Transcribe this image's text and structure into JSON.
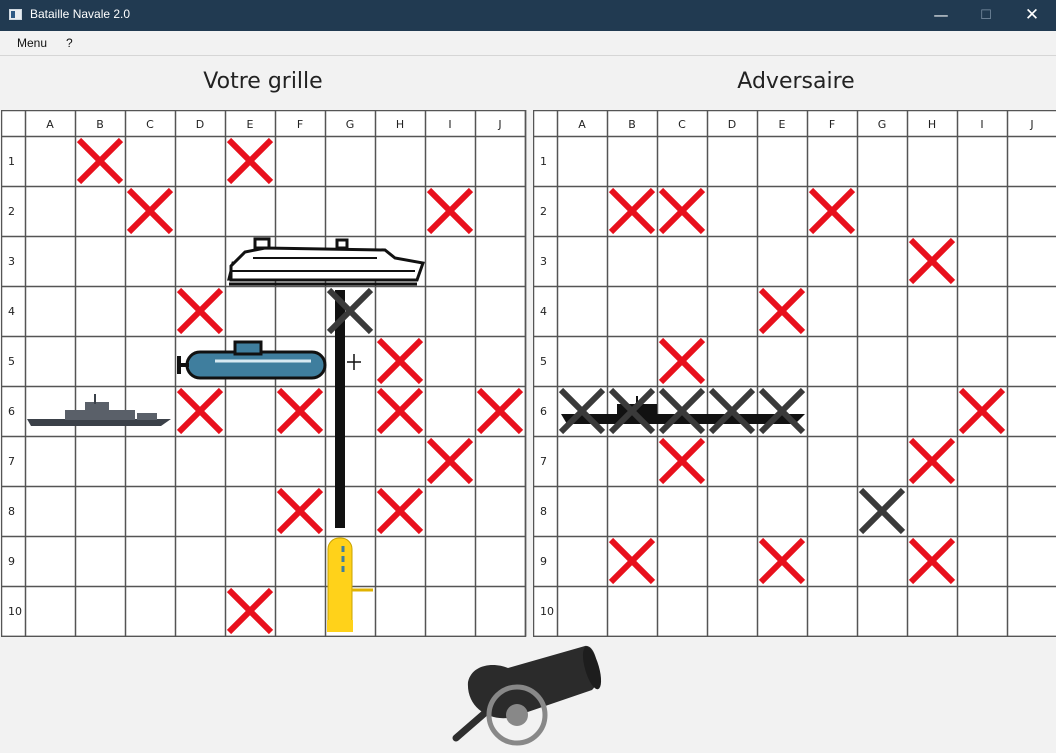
{
  "window": {
    "title": "Bataille Navale 2.0",
    "minimize": "—",
    "maximize": "☐",
    "close": "✕"
  },
  "menubar": {
    "items": [
      "Menu",
      "?"
    ]
  },
  "player_board": {
    "heading": "Votre grille",
    "columns": [
      "A",
      "B",
      "C",
      "D",
      "E",
      "F",
      "G",
      "H",
      "I",
      "J"
    ],
    "rows": [
      "1",
      "2",
      "3",
      "4",
      "5",
      "6",
      "7",
      "8",
      "9",
      "10"
    ],
    "misses": [
      "B1",
      "E1",
      "C2",
      "I2",
      "D4",
      "H5",
      "D6",
      "F6",
      "H6",
      "J6",
      "I7",
      "F8",
      "H8",
      "E10"
    ],
    "hits": [
      "G4"
    ],
    "ships": [
      {
        "name": "cruise-ship",
        "cells": [
          "E3",
          "F3",
          "G3",
          "H3"
        ],
        "orientation": "horizontal",
        "icon": "cruise-ship-icon"
      },
      {
        "name": "submarine",
        "cells": [
          "D5",
          "E5",
          "F5"
        ],
        "orientation": "horizontal",
        "icon": "submarine-icon"
      },
      {
        "name": "frigate",
        "cells": [
          "A6",
          "B6",
          "C6"
        ],
        "orientation": "horizontal",
        "icon": "frigate-icon"
      },
      {
        "name": "battleship",
        "cells": [
          "G4",
          "G5",
          "G6",
          "G7",
          "G8"
        ],
        "orientation": "vertical",
        "icon": "battleship-icon"
      },
      {
        "name": "yellow-submarine",
        "cells": [
          "G9",
          "G10"
        ],
        "orientation": "vertical",
        "icon": "yellow-submarine-icon"
      }
    ]
  },
  "opponent_board": {
    "heading": "Adversaire",
    "columns": [
      "A",
      "B",
      "C",
      "D",
      "E",
      "F",
      "G",
      "H",
      "I",
      "J"
    ],
    "rows": [
      "1",
      "2",
      "3",
      "4",
      "5",
      "6",
      "7",
      "8",
      "9",
      "10"
    ],
    "misses": [
      "B2",
      "C2",
      "F2",
      "H3",
      "E4",
      "C5",
      "I6",
      "C7",
      "H7",
      "B9",
      "E9",
      "H9"
    ],
    "hits": [
      "A6",
      "B6",
      "C6",
      "D6",
      "E6",
      "G8"
    ],
    "sunk_ships": [
      {
        "name": "sunk-battleship",
        "cells": [
          "A6",
          "B6",
          "C6",
          "D6",
          "E6"
        ],
        "orientation": "horizontal",
        "icon": "sunk-ship-silhouette-icon"
      }
    ]
  },
  "colors": {
    "miss": "#e8101c",
    "hit": "#3a3a3a",
    "grid": "#555555",
    "titlebar": "#213a51"
  },
  "cannon": {
    "icon": "cannon-icon"
  }
}
